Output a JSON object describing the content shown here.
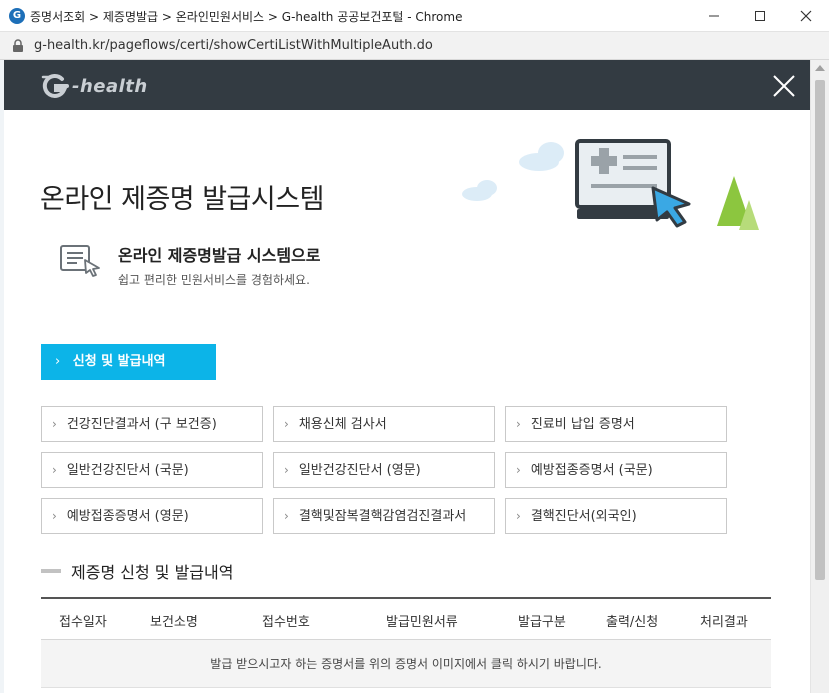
{
  "window": {
    "title": "증명서조회 > 제증명발급 > 온라인민원서비스 > G-health 공공보건포털 - Chrome",
    "app_icon_glyph": "G"
  },
  "address": {
    "url": "g-health.kr/pageflows/certi/showCertiListWithMultipleAuth.do"
  },
  "site": {
    "logo_text": "-health"
  },
  "hero": {
    "title": "온라인 제증명 발급시스템"
  },
  "intro": {
    "title": "온라인 제증명발급 시스템으로",
    "subtitle": "쉽고 편리한 민원서비스를 경험하세요."
  },
  "main_tab": {
    "label": "신청 및 발급내역",
    "chevron": "›"
  },
  "certificates": [
    {
      "label": "건강진단결과서 (구 보건증)"
    },
    {
      "label": "채용신체 검사서"
    },
    {
      "label": "진료비 납입 증명서"
    },
    {
      "label": "일반건강진단서 (국문)"
    },
    {
      "label": "일반건강진단서 (영문)"
    },
    {
      "label": "예방접종증명서 (국문)"
    },
    {
      "label": "예방접종증명서 (영문)"
    },
    {
      "label": "결핵및잠복결핵감염검진결과서"
    },
    {
      "label": "결핵진단서(외국인)"
    }
  ],
  "chevron_glyph": "›",
  "section": {
    "title": "제증명 신청 및 발급내역"
  },
  "table": {
    "headers": [
      "접수일자",
      "보건소명",
      "접수번호",
      "발급민원서류",
      "발급구분",
      "출력/신청",
      "처리결과"
    ],
    "empty_message": "발급 받으시고자 하는 증명서를 위의 증명서 이미지에서 클릭 하시기 바랍니다."
  },
  "colors": {
    "accent": "#0cb4e8",
    "header_bar": "#333b42",
    "illus_tree": "#8cc63f"
  },
  "icons": {
    "lock": "lock-icon",
    "close": "close-icon",
    "document": "document-cursor-icon"
  }
}
